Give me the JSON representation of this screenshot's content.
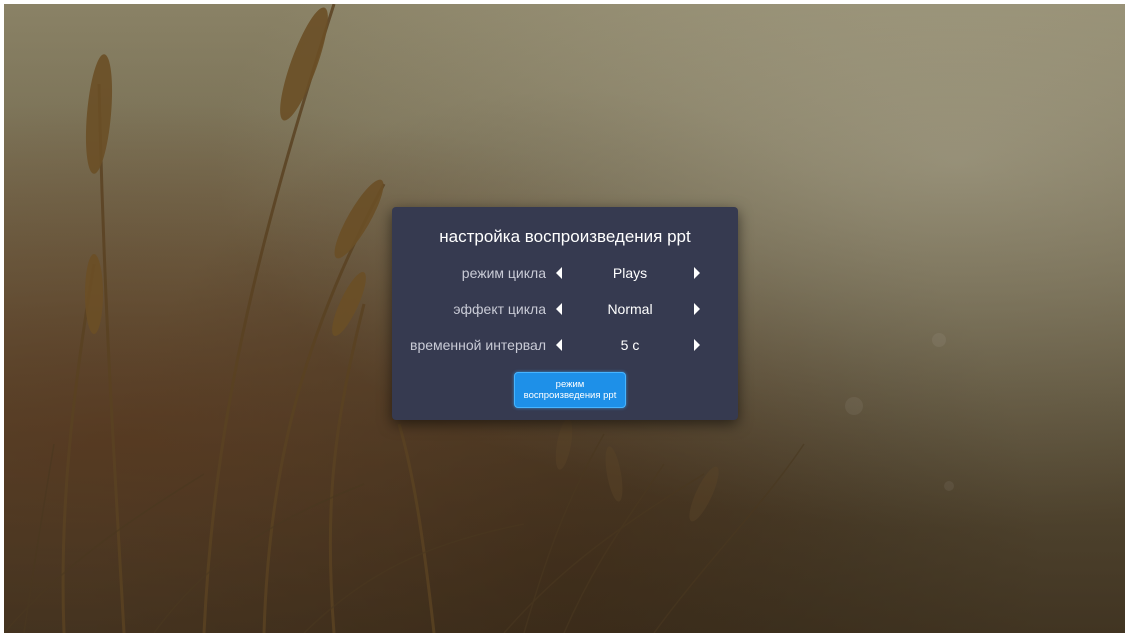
{
  "dialog": {
    "title": "настройка воспроизведения ppt",
    "settings": [
      {
        "label": "режим цикла",
        "value": "Plays"
      },
      {
        "label": "эффект цикла",
        "value": "Normal"
      },
      {
        "label": "временной интервал",
        "value": "5 с"
      }
    ],
    "button_label": "режим воспроизведения ppt"
  },
  "colors": {
    "dialog_bg": "#363a50",
    "button_bg": "#1e90e8",
    "label_text": "#c9cbd6"
  },
  "icons": {
    "prev": "triangle-left-icon",
    "next": "triangle-right-icon",
    "background": "wheat-field-background"
  }
}
